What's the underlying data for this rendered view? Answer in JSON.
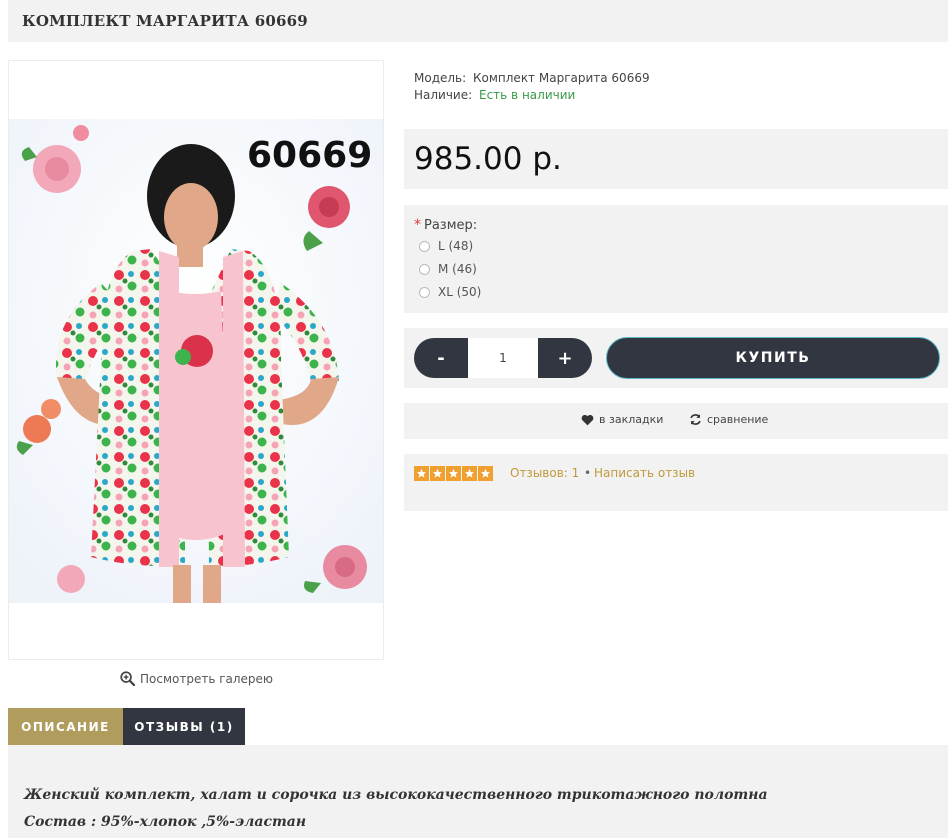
{
  "product": {
    "title": "КОМПЛЕКТ МАРГАРИТА 60669",
    "image_label": "60669",
    "gallery_link": "Посмотреть галерею"
  },
  "info": {
    "model_label": "Модель:",
    "model_value": "Комплект Маргарита 60669",
    "availability_label": "Наличие:",
    "availability_value": "Есть в наличии"
  },
  "price": "985.00 р.",
  "options": {
    "required_mark": "*",
    "size_label": "Размер:",
    "sizes": [
      "L (48)",
      "M (46)",
      "XL (50)"
    ]
  },
  "purchase": {
    "minus_label": "-",
    "quantity": "1",
    "plus_label": "+",
    "buy_label": "КУПИТЬ"
  },
  "actions": {
    "wishlist_label": "в закладки",
    "compare_label": "сравнение"
  },
  "rating": {
    "stars": 5,
    "max_stars": 5,
    "reviews_label": "Отзывов: 1",
    "separator": "•",
    "write_review_label": "Написать отзыв"
  },
  "tabs": {
    "description_label": "ОПИСАНИЕ",
    "reviews_label": "ОТЗЫВЫ (1)"
  },
  "description": {
    "line1": "Женский комплект, халат и сорочка из высококачественного трикотажного полотна",
    "line2": "Состав : 95%-хлопок ,5%-эластан"
  },
  "colors": {
    "accent_gold": "#b09c5c",
    "dark_button": "#323640",
    "available_green": "#3a9a4a",
    "star_orange": "#f0a030",
    "link_gold": "#c09a3c"
  }
}
